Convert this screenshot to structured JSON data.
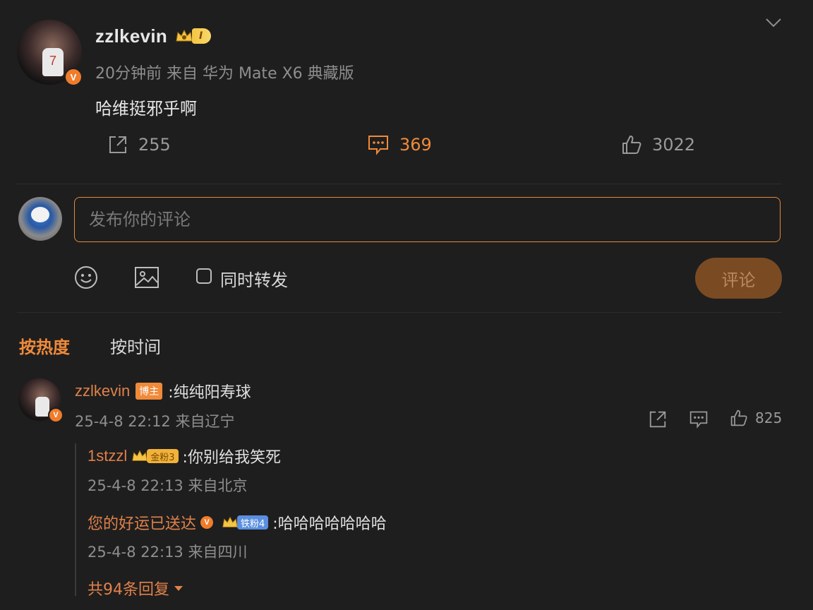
{
  "post": {
    "username": "zzlkevin",
    "level_badge": "I",
    "avatar_number": "7",
    "meta": "20分钟前 来自 华为 Mate X6 典藏版",
    "text": "哈维挺邪乎啊",
    "actions": {
      "repost_count": "255",
      "comment_count": "369",
      "like_count": "3022"
    }
  },
  "composer": {
    "placeholder": "发布你的评论",
    "repost_label": "同时转发",
    "submit_label": "评论"
  },
  "sort": {
    "hot_label": "按热度",
    "time_label": "按时间"
  },
  "comment": {
    "username": "zzlkevin",
    "role_tag": "博主",
    "text": ":纯纯阳寿球",
    "meta": "25-4-8 22:12 来自辽宁",
    "like_count": "825",
    "replies": [
      {
        "username": "1stzzl",
        "fan_badge": "金粉3",
        "text": ":你别给我笑死",
        "meta": "25-4-8 22:13 来自北京"
      },
      {
        "username": "您的好运已送达",
        "fan_badge": "铁粉4",
        "text": ":哈哈哈哈哈哈哈",
        "meta": "25-4-8 22:13 来自四川"
      }
    ],
    "more_replies": "共94条回复"
  },
  "colors": {
    "accent": "#f08a3a",
    "background": "#1e1e1e",
    "username": "#e0814a"
  }
}
